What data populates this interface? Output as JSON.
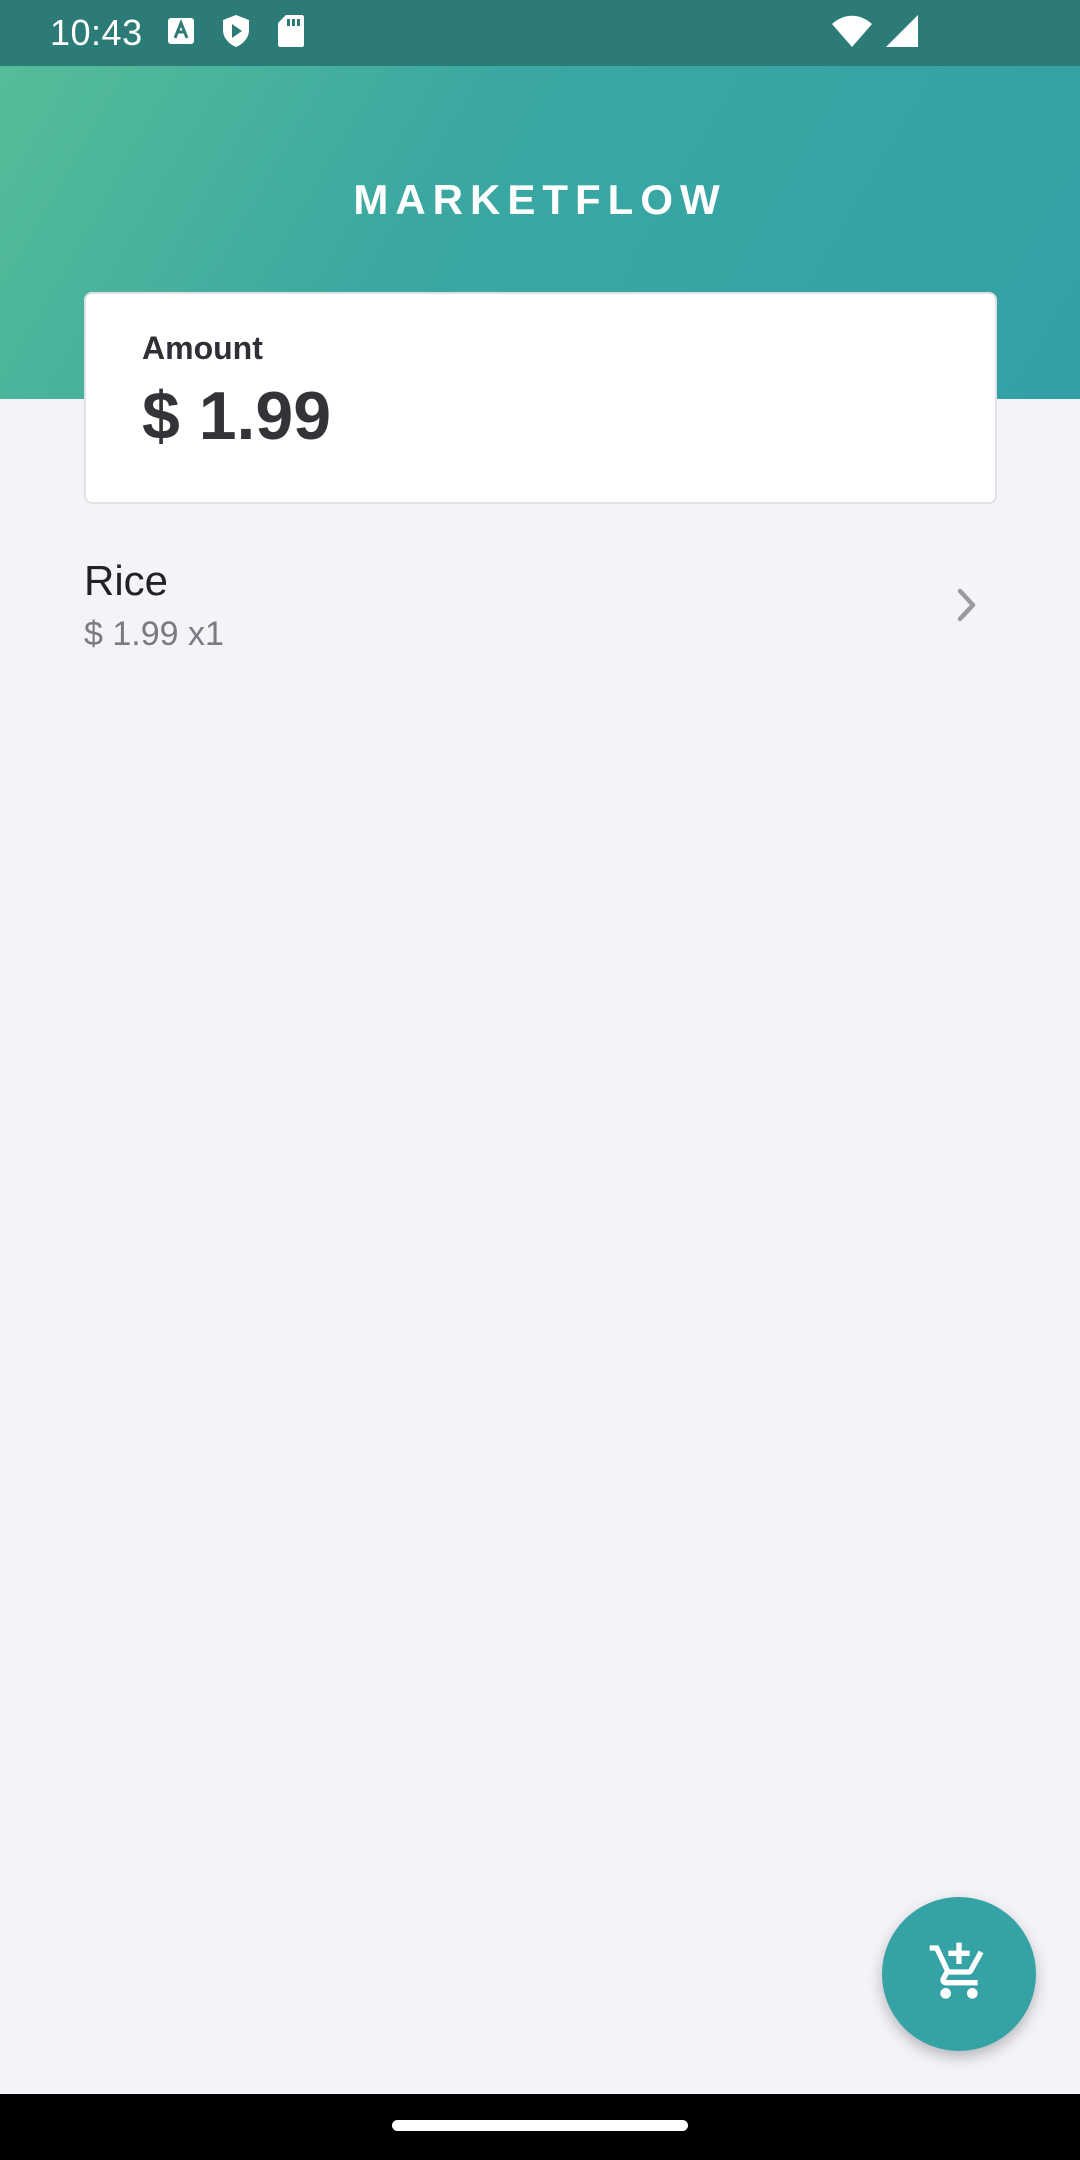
{
  "status_bar": {
    "time": "10:43",
    "icons_left": [
      "text-format-icon",
      "shield-play-icon",
      "sd-card-icon"
    ],
    "icons_right": [
      "wifi-icon",
      "signal-icon"
    ]
  },
  "header": {
    "title": "MARKETFLOW",
    "gradient_start": "#56bc98",
    "gradient_end": "#32a0a6"
  },
  "amount_card": {
    "label": "Amount",
    "value": "$ 1.99"
  },
  "items": [
    {
      "name": "Rice",
      "detail": "$ 1.99 x1",
      "icon": "chevron-right-icon"
    }
  ],
  "fab": {
    "icon": "add-to-cart-icon",
    "color": "#35a2a5"
  }
}
